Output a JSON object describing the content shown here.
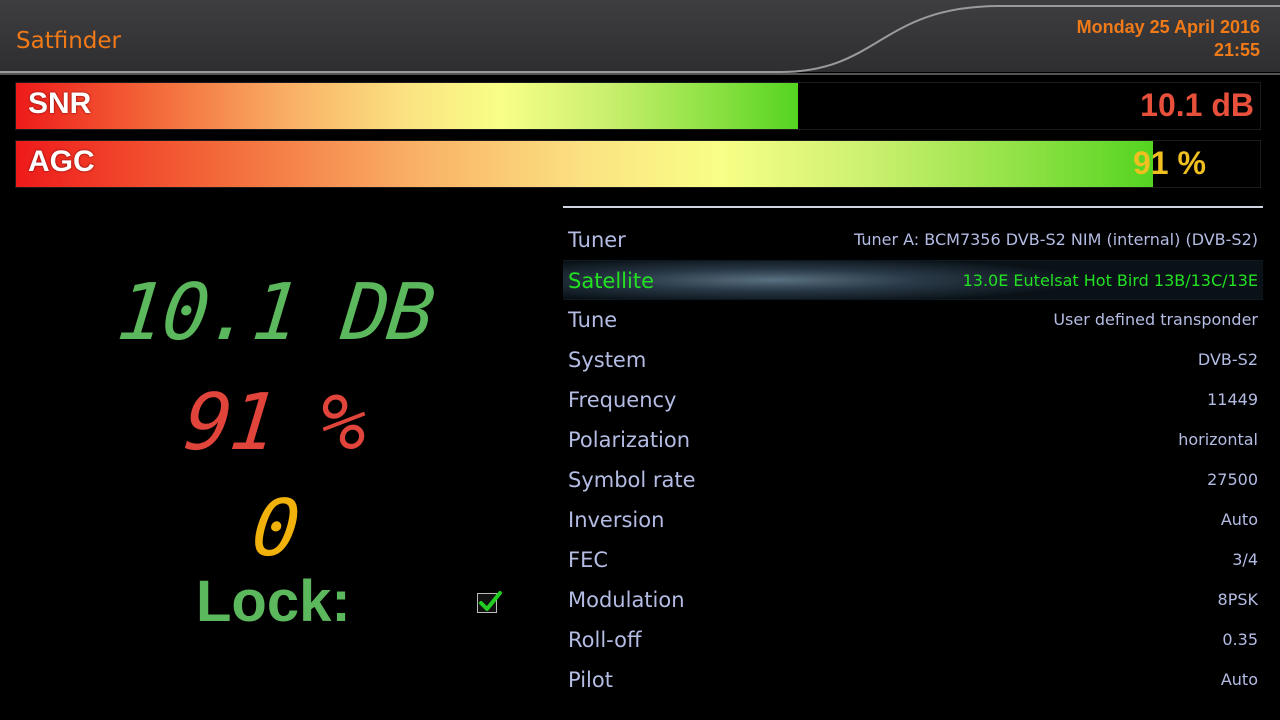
{
  "header": {
    "title": "Satfinder",
    "date": "Monday 25 April 2016",
    "time": "21:55"
  },
  "bars": {
    "snr": {
      "label": "SNR",
      "value_text": "10.1 dB",
      "fill_fraction": 0.629
    },
    "agc": {
      "label": "AGC",
      "value_text": "91 %",
      "fill_fraction": 0.914
    }
  },
  "readouts": {
    "snr": "10.1 DB",
    "agc": "91 %",
    "ber": "0",
    "lock_label": "Lock:",
    "locked": true
  },
  "info_rows": [
    {
      "key": "Tuner",
      "value": "Tuner A: BCM7356 DVB-S2 NIM (internal) (DVB-S2)"
    },
    {
      "key": "Satellite",
      "value": "13.0E Eutelsat Hot Bird 13B/13C/13E",
      "selected": true
    },
    {
      "key": "Tune",
      "value": "User defined transponder"
    },
    {
      "key": "System",
      "value": "DVB-S2"
    },
    {
      "key": "Frequency",
      "value": "11449"
    },
    {
      "key": "Polarization",
      "value": "horizontal"
    },
    {
      "key": "Symbol rate",
      "value": "27500"
    },
    {
      "key": "Inversion",
      "value": "Auto"
    },
    {
      "key": "FEC",
      "value": "3/4"
    },
    {
      "key": "Modulation",
      "value": "8PSK"
    },
    {
      "key": "Roll-off",
      "value": "0.35"
    },
    {
      "key": "Pilot",
      "value": "Auto"
    }
  ],
  "colors": {
    "accent": "#f07a18",
    "list_text": "#b4bce4",
    "selected_text": "#22e022",
    "lcd_green": "#5cb85c",
    "lcd_red": "#e0443a",
    "lcd_yellow": "#f2b20c"
  }
}
